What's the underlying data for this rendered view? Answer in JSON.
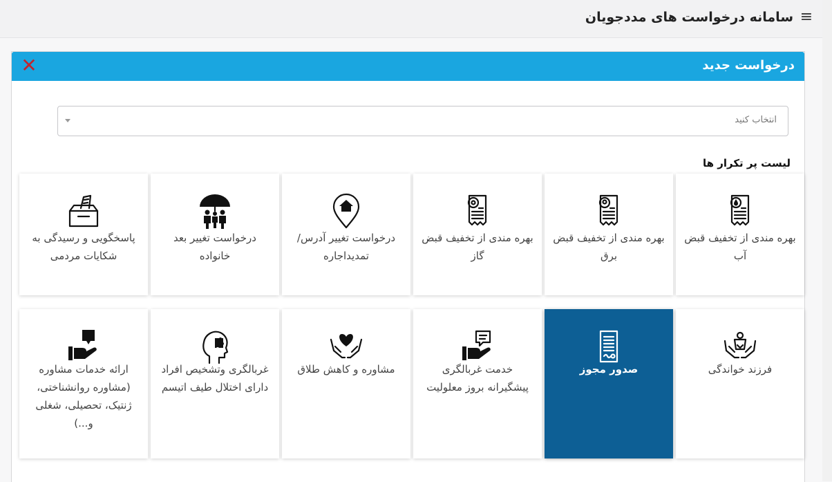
{
  "header": {
    "title": "سامانه درخواست های مددجویان",
    "menu_icon": "hamburger-icon"
  },
  "panel": {
    "title": "درخواست جدید",
    "close_icon": "close-icon",
    "select_placeholder": "انتخاب کنید",
    "list_title": "لیست پر تکرار ها"
  },
  "cards": [
    {
      "label": "بهره مندی از تخفیف قبض آب",
      "icon": "water-bill-icon"
    },
    {
      "label": "بهره مندی از تخفیف قبض برق",
      "icon": "electric-bill-icon"
    },
    {
      "label": "بهره مندی از تخفیف قبض گاز",
      "icon": "gas-bill-icon"
    },
    {
      "label": "درخواست تغییر آدرس/ تمدیداجاره",
      "icon": "home-pin-icon"
    },
    {
      "label": "درخواست تغییر بعد خانواده",
      "icon": "family-umbrella-icon"
    },
    {
      "label": "پاسخگویی و رسیدگی به شکایات مردمی",
      "icon": "complaint-box-icon"
    },
    {
      "label": "فرزند خواندگی",
      "icon": "child-hands-icon"
    },
    {
      "label": "صدور مجوز",
      "icon": "license-document-icon",
      "active": true
    },
    {
      "label": "خدمت غربالگری پیشگیرانه بروز معلولیت",
      "icon": "hand-chat-icon"
    },
    {
      "label": "مشاوره و کاهش طلاق",
      "icon": "heart-hands-icon"
    },
    {
      "label": "غربالگری وتشخیص افراد دارای اختلال طیف اتیسم",
      "icon": "head-puzzle-icon"
    },
    {
      "label": "ارائه خدمات مشاوره (مشاوره روانشناختی، ژنتیک، تحصیلی، شغلی و...)",
      "icon": "hand-question-icon"
    }
  ],
  "colors": {
    "header_blue": "#1aa6e0",
    "active_card": "#0d5f95",
    "close_red": "#c0262d"
  }
}
